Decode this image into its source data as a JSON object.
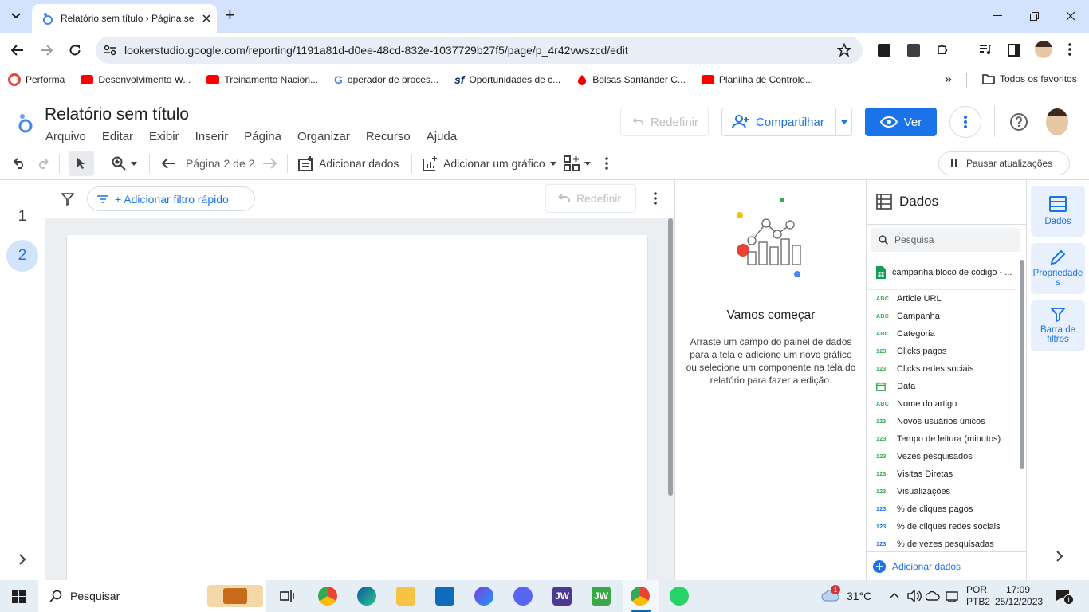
{
  "browser": {
    "tab_title": "Relatório sem título › Página se",
    "new_tab": "+",
    "url": "lookerstudio.google.com/reporting/1191a81d-d0ee-48cd-832e-1037729b27f5/page/p_4r42vwszcd/edit",
    "bookmarks": [
      {
        "label": "Performa",
        "icon": "performa-icon"
      },
      {
        "label": "Desenvolvimento W...",
        "icon": "youtube-icon"
      },
      {
        "label": "Treinamento Nacion...",
        "icon": "youtube-icon"
      },
      {
        "label": "operador de proces...",
        "icon": "google-icon"
      },
      {
        "label": "Oportunidades de c...",
        "icon": "sf-icon"
      },
      {
        "label": "Bolsas Santander C...",
        "icon": "santander-icon"
      },
      {
        "label": "Planilha de Controle...",
        "icon": "youtube-icon"
      }
    ],
    "all_bookmarks": "Todos os favoritos"
  },
  "app": {
    "title": "Relatório sem título",
    "menu": [
      "Arquivo",
      "Editar",
      "Exibir",
      "Inserir",
      "Página",
      "Organizar",
      "Recurso",
      "Ajuda"
    ],
    "reset_label": "Redefinir",
    "share_label": "Compartilhar",
    "view_label": "Ver"
  },
  "toolbar": {
    "page_label": "Página 2 de 2",
    "add_data": "Adicionar dados",
    "add_chart": "Adicionar um gráfico",
    "pause_updates": "Pausar atualizações"
  },
  "pages": {
    "items": [
      "1",
      "2"
    ],
    "active": "2"
  },
  "filterbar": {
    "add_filter": "+ Adicionar filtro rápido",
    "reset": "Redefinir"
  },
  "hint": {
    "title": "Vamos começar",
    "body": "Arraste um campo do painel de dados para a tela e adicione um novo gráfico ou selecione um componente na tela do relatório para fazer a edição."
  },
  "data_panel": {
    "title": "Dados",
    "search_placeholder": "Pesquisa",
    "source": "campanha bloco de código - ...",
    "fields": [
      {
        "type": "ABC",
        "name": "Article URL"
      },
      {
        "type": "ABC",
        "name": "Campanha"
      },
      {
        "type": "ABC",
        "name": "Categoria"
      },
      {
        "type": "123",
        "name": "Clicks pagos"
      },
      {
        "type": "123",
        "name": "Clicks redes sociais"
      },
      {
        "type": "date",
        "name": "Data"
      },
      {
        "type": "ABC",
        "name": "Nome do artigo"
      },
      {
        "type": "123",
        "name": "Novos usuários únicos"
      },
      {
        "type": "123",
        "name": "Tempo de leitura (minutos)"
      },
      {
        "type": "123",
        "name": "Vezes pesquisados"
      },
      {
        "type": "123",
        "name": "Visitas Diretas"
      },
      {
        "type": "123",
        "name": "Visualizações"
      },
      {
        "type": "123b",
        "name": "% de cliques pagos"
      },
      {
        "type": "123b",
        "name": "% de cliques redes sociais"
      },
      {
        "type": "123b",
        "name": "% de vezes pesquisadas"
      }
    ],
    "add_data": "Adicionar dados"
  },
  "rail": {
    "data": "Dados",
    "properties": "Propriedades",
    "filter_bar": "Barra de filtros"
  },
  "taskbar": {
    "search": "Pesquisar",
    "weather": "31°C",
    "lang1": "POR",
    "lang2": "PTB2",
    "time": "17:09",
    "date": "25/12/2023",
    "notif_count": "1",
    "weather_badge": "1"
  },
  "colors": {
    "accent": "#1a73e8",
    "tabstrip": "#d3e3fd",
    "taskbar": "#e5edf5"
  }
}
